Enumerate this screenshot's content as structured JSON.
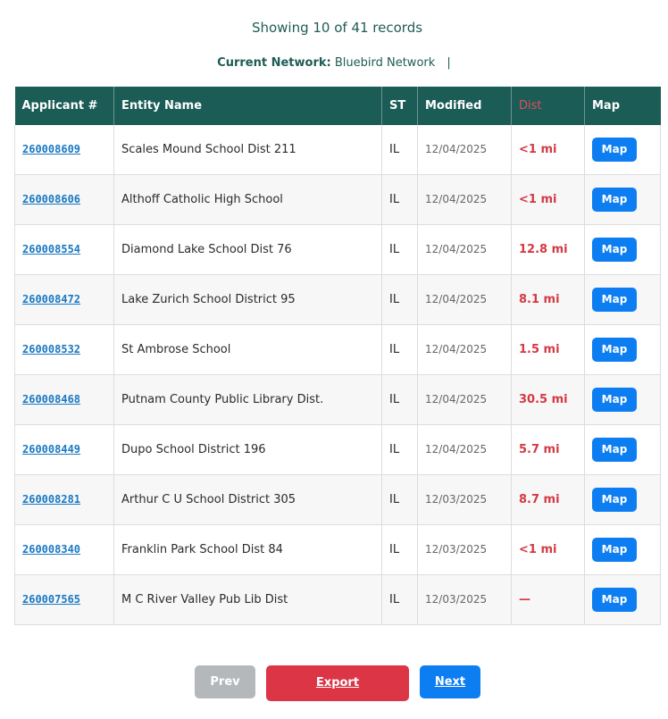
{
  "summary": "Showing 10 of 41 records",
  "network": {
    "label": "Current Network:",
    "value": "Bluebird Network",
    "separator": "|"
  },
  "columns": [
    "Applicant #",
    "Entity Name",
    "ST",
    "Modified",
    "Dist",
    "Map"
  ],
  "rows": [
    {
      "applicant": "260008609",
      "entity": "Scales Mound School Dist 211",
      "st": "IL",
      "modified": "12/04/2025",
      "dist": "<1 mi",
      "map": "Map"
    },
    {
      "applicant": "260008606",
      "entity": "Althoff Catholic High School",
      "st": "IL",
      "modified": "12/04/2025",
      "dist": "<1 mi",
      "map": "Map"
    },
    {
      "applicant": "260008554",
      "entity": "Diamond Lake School Dist 76",
      "st": "IL",
      "modified": "12/04/2025",
      "dist": "12.8 mi",
      "map": "Map"
    },
    {
      "applicant": "260008472",
      "entity": "Lake Zurich School District 95",
      "st": "IL",
      "modified": "12/04/2025",
      "dist": "8.1 mi",
      "map": "Map"
    },
    {
      "applicant": "260008532",
      "entity": "St Ambrose School",
      "st": "IL",
      "modified": "12/04/2025",
      "dist": "1.5 mi",
      "map": "Map"
    },
    {
      "applicant": "260008468",
      "entity": "Putnam County Public Library Dist.",
      "st": "IL",
      "modified": "12/04/2025",
      "dist": "30.5 mi",
      "map": "Map"
    },
    {
      "applicant": "260008449",
      "entity": "Dupo School District 196",
      "st": "IL",
      "modified": "12/04/2025",
      "dist": "5.7 mi",
      "map": "Map"
    },
    {
      "applicant": "260008281",
      "entity": "Arthur C U School District 305",
      "st": "IL",
      "modified": "12/03/2025",
      "dist": "8.7 mi",
      "map": "Map"
    },
    {
      "applicant": "260008340",
      "entity": "Franklin Park School Dist 84",
      "st": "IL",
      "modified": "12/03/2025",
      "dist": "<1 mi",
      "map": "Map"
    },
    {
      "applicant": "260007565",
      "entity": "M C River Valley Pub Lib Dist",
      "st": "IL",
      "modified": "12/03/2025",
      "dist": "—",
      "map": "Map"
    }
  ],
  "pagination": {
    "prev": "Prev",
    "export": "Export",
    "next": "Next"
  },
  "colors": {
    "header_bg": "#1b5c56",
    "title_text": "#1e5c55",
    "link": "#1a78c2",
    "dist_text": "#d33a44",
    "map_button": "#0d7ef2",
    "export_button": "#dc3545",
    "prev_button": "#b5b8bb"
  }
}
